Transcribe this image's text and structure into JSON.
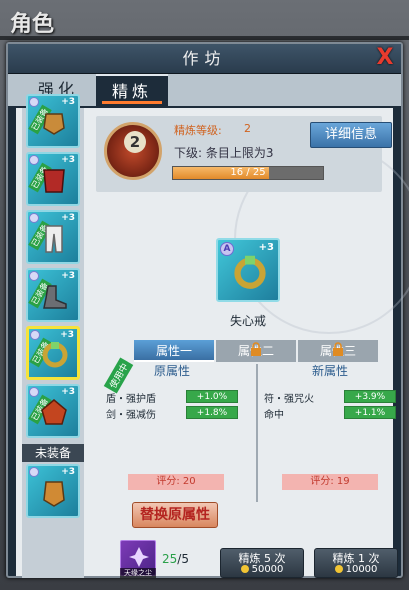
{
  "background": {
    "title": "角色"
  },
  "window": {
    "title": "作坊",
    "close_symbol": "X"
  },
  "tabs": [
    {
      "label": "强化",
      "active": false
    },
    {
      "label": "精炼",
      "active": true
    }
  ],
  "equipment_list": {
    "slots": [
      {
        "icon": "glove-icon",
        "plus": "+3",
        "tag": "已装备"
      },
      {
        "icon": "armor-icon",
        "plus": "+3",
        "tag": "已装备"
      },
      {
        "icon": "pants-icon",
        "plus": "+3",
        "tag": "已装备"
      },
      {
        "icon": "boots-icon",
        "plus": "+3",
        "tag": "已装备"
      },
      {
        "icon": "ring-icon",
        "plus": "+3",
        "tag": "已装备",
        "selected": true
      },
      {
        "icon": "shoulder-armor-icon",
        "plus": "+3",
        "tag": "已装备"
      },
      {
        "icon": "gauntlet-icon",
        "plus": "+3",
        "tag": ""
      }
    ],
    "unequipped_label": "未装备"
  },
  "refine": {
    "medal_number": "2",
    "level_label": "精炼等级:",
    "level_value": "2",
    "next_level_text": "下级: 条目上限为3",
    "progress_text": "16 / 25",
    "progress_fraction": 0.64,
    "detail_button": "详细信息"
  },
  "item": {
    "name": "失心戒",
    "badge": "A",
    "plus": "+3"
  },
  "attribute_tabs": [
    {
      "label": "属性一",
      "locked": false
    },
    {
      "label": "属性二",
      "locked": true
    },
    {
      "label": "属性三",
      "locked": true
    }
  ],
  "in_use_tag": "使用中",
  "original": {
    "title": "原属性",
    "attrs": [
      {
        "name": "盾・强护盾",
        "value": "+1.0%"
      },
      {
        "name": "剑・强减伤",
        "value": "+1.8%"
      }
    ],
    "score": "评分: 20"
  },
  "new": {
    "title": "新属性",
    "attrs": [
      {
        "name": "符・强咒火",
        "value": "+3.9%"
      },
      {
        "name": "命中",
        "value": "+1.1%"
      }
    ],
    "score": "评分: 19"
  },
  "replace_button": "替换原属性",
  "material": {
    "name": "天缘之尘",
    "have": "25",
    "need": "/5"
  },
  "refine_buttons": [
    {
      "label": "精炼 5 次",
      "cost": "50000"
    },
    {
      "label": "精炼 1 次",
      "cost": "10000"
    }
  ],
  "colors": {
    "accent_orange": "#ff7b2e",
    "attr_green": "#37a84a",
    "score_red": "#c23a2e",
    "close_red": "#e83b2e"
  }
}
